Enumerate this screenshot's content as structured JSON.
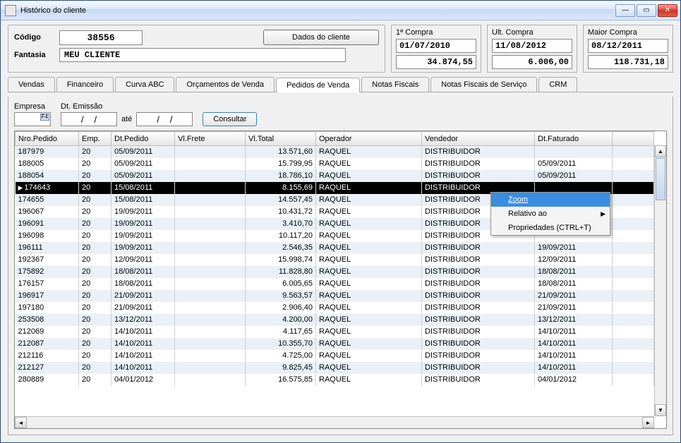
{
  "window": {
    "title": "Histórico do cliente"
  },
  "header": {
    "codigo_label": "Código",
    "codigo_value": "38556",
    "fantasia_label": "Fantasia",
    "fantasia_value": "MEU CLIENTE",
    "dados_btn": "Dados do cliente"
  },
  "summary": {
    "primeira_compra": {
      "label": "1ª Compra",
      "date": "01/07/2010",
      "value": "34.874,55"
    },
    "ult_compra": {
      "label": "Ult. Compra",
      "date": "11/08/2012",
      "value": "6.006,00"
    },
    "maior_compra": {
      "label": "Maior Compra",
      "date": "08/12/2011",
      "value": "118.731,18"
    }
  },
  "tabs": {
    "vendas": "Vendas",
    "financeiro": "Financeiro",
    "curva_abc": "Curva ABC",
    "orcamentos": "Orçamentos de Venda",
    "pedidos": "Pedidos de Venda",
    "notas": "Notas Fiscais",
    "notas_servico": "Notas Fiscais de Serviço",
    "crm": "CRM",
    "active": "pedidos"
  },
  "filters": {
    "empresa_label": "Empresa",
    "empresa_value": "",
    "dt_emissao_label": "Dt. Emissão",
    "ate_label": "até",
    "date_mask": "/    /",
    "consultar_btn": "Consultar"
  },
  "grid": {
    "columns": [
      "Nro.Pedido",
      "Emp.",
      "Dt.Pedido",
      "Vl.Frete",
      "Vl.Total",
      "Operador",
      "Vendedor",
      "Dt.Faturado"
    ],
    "rows": [
      {
        "n": "187979",
        "e": "20",
        "d": "05/09/2011",
        "f": "",
        "t": "13.571,60",
        "op": "RAQUEL",
        "v": "DISTRIBUIDOR",
        "df": ""
      },
      {
        "n": "188005",
        "e": "20",
        "d": "05/09/2011",
        "f": "",
        "t": "15.799,95",
        "op": "RAQUEL",
        "v": "DISTRIBUIDOR",
        "df": "05/09/2011"
      },
      {
        "n": "188054",
        "e": "20",
        "d": "05/09/2011",
        "f": "",
        "t": "18.786,10",
        "op": "RAQUEL",
        "v": "DISTRIBUIDOR",
        "df": "05/09/2011"
      },
      {
        "n": "174643",
        "e": "20",
        "d": "15/08/2011",
        "f": "",
        "t": "8.155,69",
        "op": "RAQUEL",
        "v": "DISTRIBUIDOR",
        "df": "",
        "sel": true
      },
      {
        "n": "174655",
        "e": "20",
        "d": "15/08/2011",
        "f": "",
        "t": "14.557,45",
        "op": "RAQUEL",
        "v": "DISTRIBUIDOR",
        "df": ""
      },
      {
        "n": "196067",
        "e": "20",
        "d": "19/09/2011",
        "f": "",
        "t": "10.431,72",
        "op": "RAQUEL",
        "v": "DISTRIBUIDOR",
        "df": ""
      },
      {
        "n": "196091",
        "e": "20",
        "d": "19/09/2011",
        "f": "",
        "t": "3.410,70",
        "op": "RAQUEL",
        "v": "DISTRIBUIDOR",
        "df": ""
      },
      {
        "n": "196098",
        "e": "20",
        "d": "19/09/2011",
        "f": "",
        "t": "10.117,20",
        "op": "RAQUEL",
        "v": "DISTRIBUIDOR",
        "df": ""
      },
      {
        "n": "196111",
        "e": "20",
        "d": "19/09/2011",
        "f": "",
        "t": "2.546,35",
        "op": "RAQUEL",
        "v": "DISTRIBUIDOR",
        "df": "19/09/2011"
      },
      {
        "n": "192367",
        "e": "20",
        "d": "12/09/2011",
        "f": "",
        "t": "15.998,74",
        "op": "RAQUEL",
        "v": "DISTRIBUIDOR",
        "df": "12/09/2011"
      },
      {
        "n": "175892",
        "e": "20",
        "d": "18/08/2011",
        "f": "",
        "t": "11.828,80",
        "op": "RAQUEL",
        "v": "DISTRIBUIDOR",
        "df": "18/08/2011"
      },
      {
        "n": "176157",
        "e": "20",
        "d": "18/08/2011",
        "f": "",
        "t": "6.005,65",
        "op": "RAQUEL",
        "v": "DISTRIBUIDOR",
        "df": "18/08/2011"
      },
      {
        "n": "196917",
        "e": "20",
        "d": "21/09/2011",
        "f": "",
        "t": "9.563,57",
        "op": "RAQUEL",
        "v": "DISTRIBUIDOR",
        "df": "21/09/2011"
      },
      {
        "n": "197180",
        "e": "20",
        "d": "21/09/2011",
        "f": "",
        "t": "2.906,40",
        "op": "RAQUEL",
        "v": "DISTRIBUIDOR",
        "df": "21/09/2011"
      },
      {
        "n": "253508",
        "e": "20",
        "d": "13/12/2011",
        "f": "",
        "t": "4.200,00",
        "op": "RAQUEL",
        "v": "DISTRIBUIDOR",
        "df": "13/12/2011"
      },
      {
        "n": "212069",
        "e": "20",
        "d": "14/10/2011",
        "f": "",
        "t": "4.117,65",
        "op": "RAQUEL",
        "v": "DISTRIBUIDOR",
        "df": "14/10/2011"
      },
      {
        "n": "212087",
        "e": "20",
        "d": "14/10/2011",
        "f": "",
        "t": "10.355,70",
        "op": "RAQUEL",
        "v": "DISTRIBUIDOR",
        "df": "14/10/2011"
      },
      {
        "n": "212116",
        "e": "20",
        "d": "14/10/2011",
        "f": "",
        "t": "4.725,00",
        "op": "RAQUEL",
        "v": "DISTRIBUIDOR",
        "df": "14/10/2011"
      },
      {
        "n": "212127",
        "e": "20",
        "d": "14/10/2011",
        "f": "",
        "t": "9.825,45",
        "op": "RAQUEL",
        "v": "DISTRIBUIDOR",
        "df": "14/10/2011"
      },
      {
        "n": "280889",
        "e": "20",
        "d": "04/01/2012",
        "f": "",
        "t": "16.575,85",
        "op": "RAQUEL",
        "v": "DISTRIBUIDOR",
        "df": "04/01/2012"
      }
    ]
  },
  "context_menu": {
    "zoom": "Zoom",
    "relativo": "Relativo ao",
    "propriedades": "Propriedades (CTRL+T)"
  }
}
